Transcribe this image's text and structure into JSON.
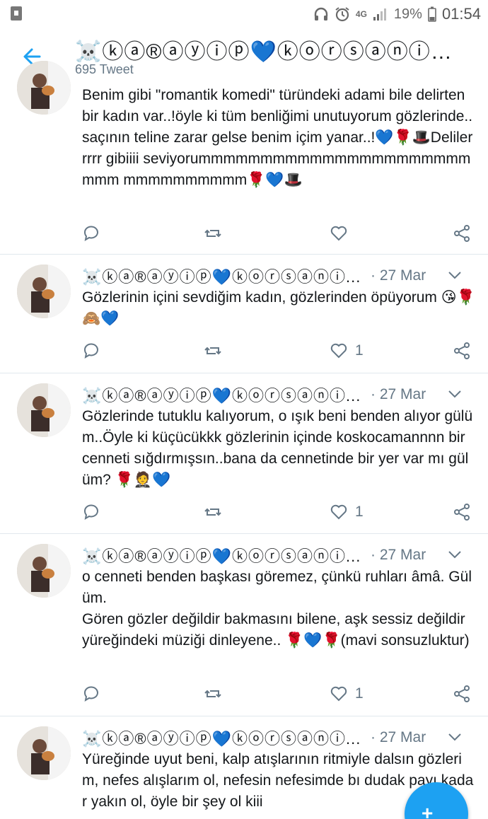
{
  "status_bar": {
    "network": "4G",
    "battery": "19%",
    "time": "01:54"
  },
  "header": {
    "title": "☠️ⓚⓐ®ⓐⓨⓘⓟ💙ⓚⓞⓡⓢⓐⓝⓘ☠️...",
    "tweet_count": "695 Tweet"
  },
  "tweets": [
    {
      "author": "",
      "date": "",
      "text": "Benim gibi \"romantik komedi\" türündeki adami bile delirten bir kadın var..!öyle ki tüm benliğimi unutuyorum gözlerinde.. saçının teline zarar gelse benim içim yanar..!💙🌹🎩Delilerrrrr gibiiii seviyorummmmmmmmmmmmmmmmmmmmmmmmm mmmmmmmmmm🌹💙🎩",
      "likes": ""
    },
    {
      "author": "☠️ⓚⓐ®ⓐⓨⓘⓟ💙ⓚⓞⓡⓢⓐⓝⓘ...",
      "date": "· 27 Mar",
      "text": "Gözlerinin içini sevdiğim kadın, gözlerinden öpüyorum 😘🌹🙈💙",
      "likes": "1"
    },
    {
      "author": "☠️ⓚⓐ®ⓐⓨⓘⓟ💙ⓚⓞⓡⓢⓐⓝⓘ...",
      "date": "· 27 Mar",
      "text": "Gözlerinde tutuklu kalıyorum, o ışık beni benden alıyor gülüm..Öyle ki küçücükkk gözlerinin içinde koskocamannnn bir cenneti sığdırmışsın..bana da cennetinde bir yer var mı gülüm? 🌹🤵💙",
      "likes": "1"
    },
    {
      "author": "☠️ⓚⓐ®ⓐⓨⓘⓟ💙ⓚⓞⓡⓢⓐⓝⓘ...",
      "date": "· 27 Mar",
      "text": "o cenneti benden başkası göremez, çünkü ruhları âmâ. Gülüm.\nGören gözler değildir bakmasını bilene, aşk sessiz değildir yüreğindeki müziği dinleyene.. 🌹💙🌹(mavi sonsuzluktur)",
      "likes": "1"
    },
    {
      "author": "☠️ⓚⓐ®ⓐⓨⓘⓟ💙ⓚⓞⓡⓢⓐⓝⓘ...",
      "date": "· 27 Mar",
      "text": "Yüreğinde uyut beni, kalp atışlarının ritmiyle dalsın gözlerim, nefes alışlarım ol, nefesin nefesimde bı dudak payı kadar yakın ol, öyle bir şey ol kiii",
      "likes": ""
    }
  ],
  "fab": {
    "label": "+"
  },
  "colors": {
    "accent": "#1da1f2",
    "muted": "#657786",
    "divider": "#e1e8ed"
  }
}
